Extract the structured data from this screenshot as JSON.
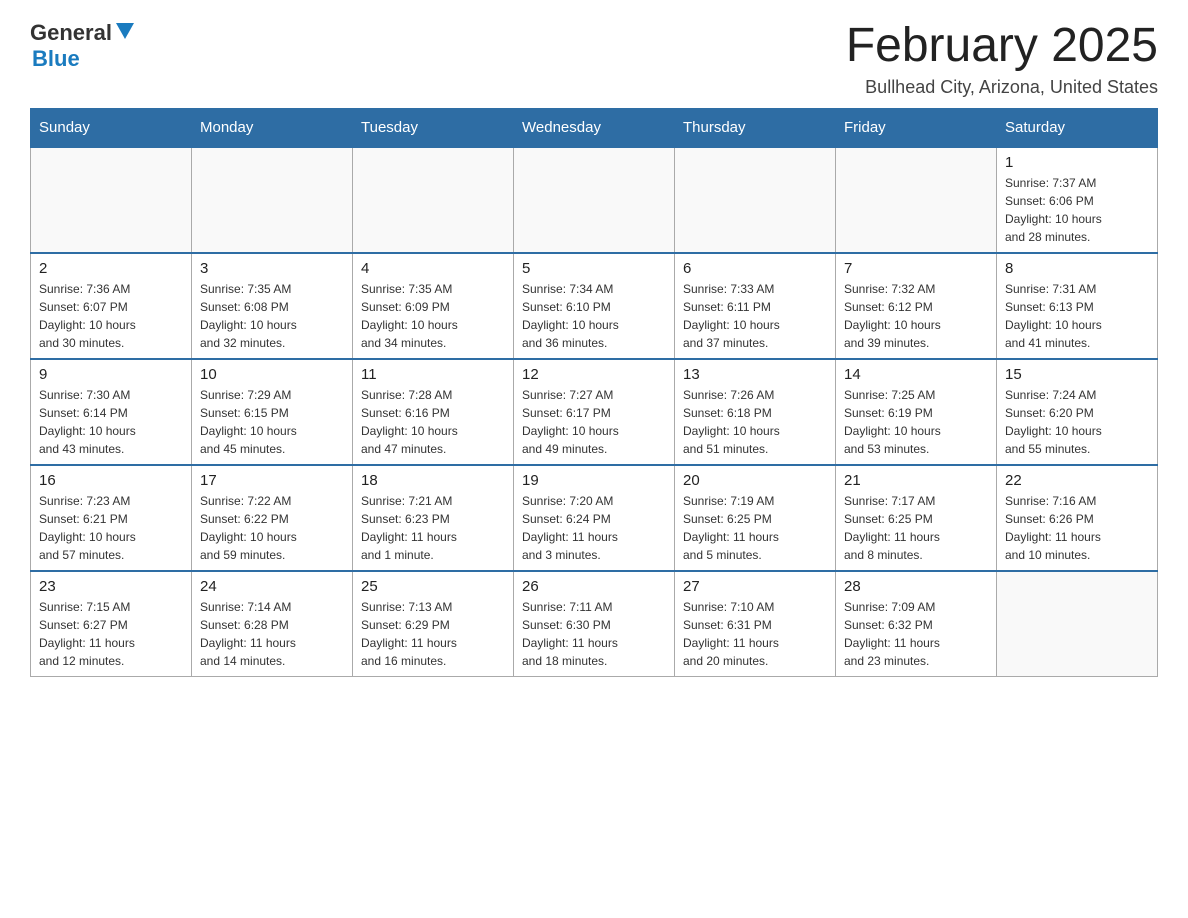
{
  "header": {
    "logo_general": "General",
    "logo_blue": "Blue",
    "month_title": "February 2025",
    "location": "Bullhead City, Arizona, United States"
  },
  "weekdays": [
    "Sunday",
    "Monday",
    "Tuesday",
    "Wednesday",
    "Thursday",
    "Friday",
    "Saturday"
  ],
  "weeks": [
    [
      {
        "day": "",
        "info": ""
      },
      {
        "day": "",
        "info": ""
      },
      {
        "day": "",
        "info": ""
      },
      {
        "day": "",
        "info": ""
      },
      {
        "day": "",
        "info": ""
      },
      {
        "day": "",
        "info": ""
      },
      {
        "day": "1",
        "info": "Sunrise: 7:37 AM\nSunset: 6:06 PM\nDaylight: 10 hours\nand 28 minutes."
      }
    ],
    [
      {
        "day": "2",
        "info": "Sunrise: 7:36 AM\nSunset: 6:07 PM\nDaylight: 10 hours\nand 30 minutes."
      },
      {
        "day": "3",
        "info": "Sunrise: 7:35 AM\nSunset: 6:08 PM\nDaylight: 10 hours\nand 32 minutes."
      },
      {
        "day": "4",
        "info": "Sunrise: 7:35 AM\nSunset: 6:09 PM\nDaylight: 10 hours\nand 34 minutes."
      },
      {
        "day": "5",
        "info": "Sunrise: 7:34 AM\nSunset: 6:10 PM\nDaylight: 10 hours\nand 36 minutes."
      },
      {
        "day": "6",
        "info": "Sunrise: 7:33 AM\nSunset: 6:11 PM\nDaylight: 10 hours\nand 37 minutes."
      },
      {
        "day": "7",
        "info": "Sunrise: 7:32 AM\nSunset: 6:12 PM\nDaylight: 10 hours\nand 39 minutes."
      },
      {
        "day": "8",
        "info": "Sunrise: 7:31 AM\nSunset: 6:13 PM\nDaylight: 10 hours\nand 41 minutes."
      }
    ],
    [
      {
        "day": "9",
        "info": "Sunrise: 7:30 AM\nSunset: 6:14 PM\nDaylight: 10 hours\nand 43 minutes."
      },
      {
        "day": "10",
        "info": "Sunrise: 7:29 AM\nSunset: 6:15 PM\nDaylight: 10 hours\nand 45 minutes."
      },
      {
        "day": "11",
        "info": "Sunrise: 7:28 AM\nSunset: 6:16 PM\nDaylight: 10 hours\nand 47 minutes."
      },
      {
        "day": "12",
        "info": "Sunrise: 7:27 AM\nSunset: 6:17 PM\nDaylight: 10 hours\nand 49 minutes."
      },
      {
        "day": "13",
        "info": "Sunrise: 7:26 AM\nSunset: 6:18 PM\nDaylight: 10 hours\nand 51 minutes."
      },
      {
        "day": "14",
        "info": "Sunrise: 7:25 AM\nSunset: 6:19 PM\nDaylight: 10 hours\nand 53 minutes."
      },
      {
        "day": "15",
        "info": "Sunrise: 7:24 AM\nSunset: 6:20 PM\nDaylight: 10 hours\nand 55 minutes."
      }
    ],
    [
      {
        "day": "16",
        "info": "Sunrise: 7:23 AM\nSunset: 6:21 PM\nDaylight: 10 hours\nand 57 minutes."
      },
      {
        "day": "17",
        "info": "Sunrise: 7:22 AM\nSunset: 6:22 PM\nDaylight: 10 hours\nand 59 minutes."
      },
      {
        "day": "18",
        "info": "Sunrise: 7:21 AM\nSunset: 6:23 PM\nDaylight: 11 hours\nand 1 minute."
      },
      {
        "day": "19",
        "info": "Sunrise: 7:20 AM\nSunset: 6:24 PM\nDaylight: 11 hours\nand 3 minutes."
      },
      {
        "day": "20",
        "info": "Sunrise: 7:19 AM\nSunset: 6:25 PM\nDaylight: 11 hours\nand 5 minutes."
      },
      {
        "day": "21",
        "info": "Sunrise: 7:17 AM\nSunset: 6:25 PM\nDaylight: 11 hours\nand 8 minutes."
      },
      {
        "day": "22",
        "info": "Sunrise: 7:16 AM\nSunset: 6:26 PM\nDaylight: 11 hours\nand 10 minutes."
      }
    ],
    [
      {
        "day": "23",
        "info": "Sunrise: 7:15 AM\nSunset: 6:27 PM\nDaylight: 11 hours\nand 12 minutes."
      },
      {
        "day": "24",
        "info": "Sunrise: 7:14 AM\nSunset: 6:28 PM\nDaylight: 11 hours\nand 14 minutes."
      },
      {
        "day": "25",
        "info": "Sunrise: 7:13 AM\nSunset: 6:29 PM\nDaylight: 11 hours\nand 16 minutes."
      },
      {
        "day": "26",
        "info": "Sunrise: 7:11 AM\nSunset: 6:30 PM\nDaylight: 11 hours\nand 18 minutes."
      },
      {
        "day": "27",
        "info": "Sunrise: 7:10 AM\nSunset: 6:31 PM\nDaylight: 11 hours\nand 20 minutes."
      },
      {
        "day": "28",
        "info": "Sunrise: 7:09 AM\nSunset: 6:32 PM\nDaylight: 11 hours\nand 23 minutes."
      },
      {
        "day": "",
        "info": ""
      }
    ]
  ]
}
